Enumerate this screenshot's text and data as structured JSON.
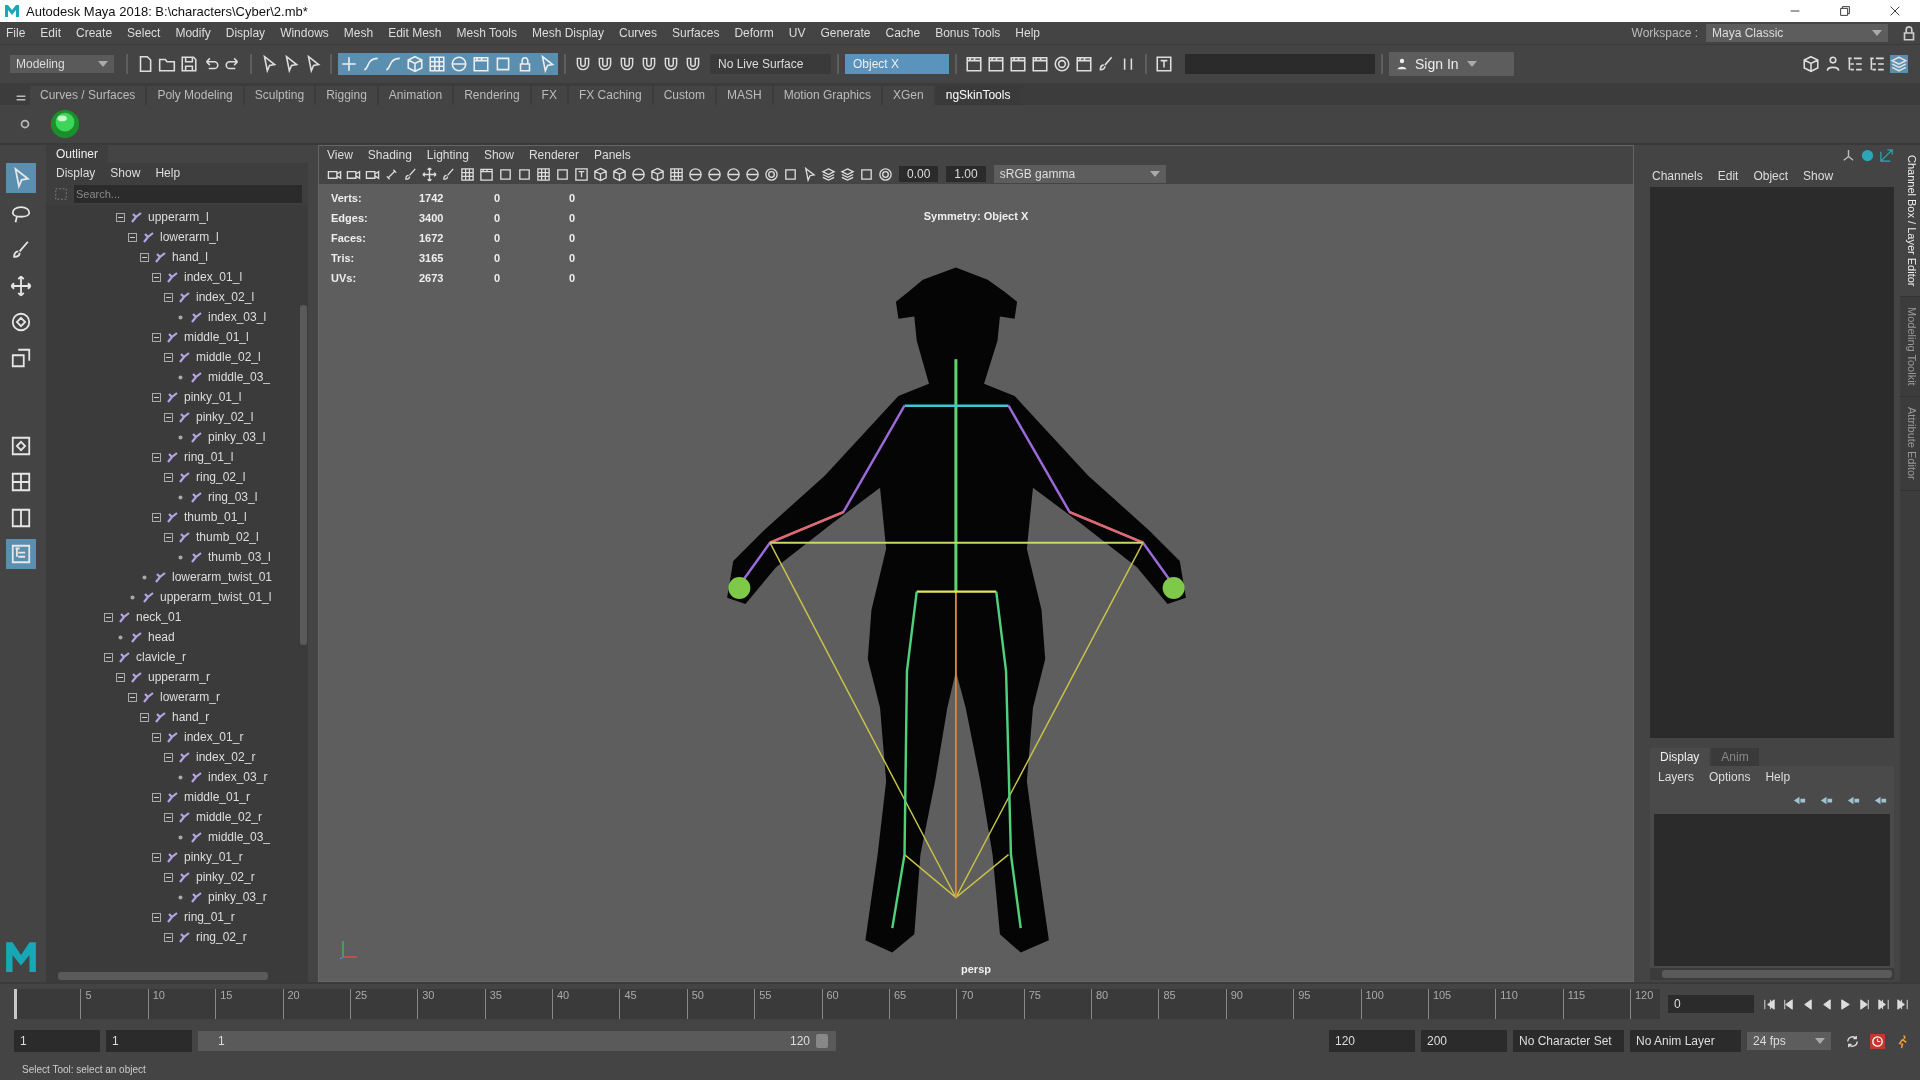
{
  "window": {
    "title": "Autodesk Maya 2018: B:\\characters\\Cyber\\2.mb*"
  },
  "menu_bar": [
    "File",
    "Edit",
    "Create",
    "Select",
    "Modify",
    "Display",
    "Windows",
    "Mesh",
    "Edit Mesh",
    "Mesh Tools",
    "Mesh Display",
    "Curves",
    "Surfaces",
    "Deform",
    "UV",
    "Generate",
    "Cache",
    "Bonus Tools",
    "Help"
  ],
  "workspace": {
    "label": "Workspace :",
    "value": "Maya Classic"
  },
  "status_line": {
    "menu_set": "Modeling",
    "live_surface": "No Live Surface",
    "symmetry": "Object X",
    "sign_in": "Sign In"
  },
  "shelf_tabs": [
    {
      "label": "Curves / Surfaces",
      "selected": false
    },
    {
      "label": "Poly Modeling",
      "selected": false
    },
    {
      "label": "Sculpting",
      "selected": false
    },
    {
      "label": "Rigging",
      "selected": false
    },
    {
      "label": "Animation",
      "selected": false
    },
    {
      "label": "Rendering",
      "selected": false
    },
    {
      "label": "FX",
      "selected": false
    },
    {
      "label": "FX Caching",
      "selected": false
    },
    {
      "label": "Custom",
      "selected": false
    },
    {
      "label": "MASH",
      "selected": false
    },
    {
      "label": "Motion Graphics",
      "selected": false
    },
    {
      "label": "XGen",
      "selected": false
    },
    {
      "label": "ngSkinTools",
      "selected": true
    }
  ],
  "toolbox": [
    {
      "kind": "select",
      "selected": true
    },
    {
      "kind": "lasso",
      "selected": false
    },
    {
      "kind": "paint",
      "selected": false
    },
    {
      "kind": "move",
      "selected": false
    },
    {
      "kind": "rotate",
      "selected": false
    },
    {
      "kind": "scale",
      "selected": false
    },
    {
      "kind": "single",
      "selected": false
    },
    {
      "kind": "four",
      "selected": false
    },
    {
      "kind": "two",
      "selected": false
    },
    {
      "kind": "outliner",
      "selected": true
    }
  ],
  "outliner": {
    "title": "Outliner",
    "menu": [
      "Display",
      "Show",
      "Help"
    ],
    "search": {
      "placeholder": "Search..."
    },
    "tree": [
      {
        "children": [
          {
            "label": "upperarm_l",
            "expanded": true,
            "children": [
              {
                "label": "lowerarm_l",
                "expanded": true,
                "children": [
                  {
                    "label": "hand_l",
                    "expanded": true,
                    "children": [
                      {
                        "label": "index_01_l",
                        "expanded": true,
                        "children": [
                          {
                            "label": "index_02_l",
                            "expanded": true,
                            "children": [
                              {
                                "label": "index_03_l"
                              }
                            ]
                          }
                        ]
                      },
                      {
                        "label": "middle_01_l",
                        "expanded": true,
                        "children": [
                          {
                            "label": "middle_02_l",
                            "expanded": true,
                            "children": [
                              {
                                "label": "middle_03_"
                              }
                            ]
                          }
                        ]
                      },
                      {
                        "label": "pinky_01_l",
                        "expanded": true,
                        "children": [
                          {
                            "label": "pinky_02_l",
                            "expanded": true,
                            "children": [
                              {
                                "label": "pinky_03_l"
                              }
                            ]
                          }
                        ]
                      },
                      {
                        "label": "ring_01_l",
                        "expanded": true,
                        "children": [
                          {
                            "label": "ring_02_l",
                            "expanded": true,
                            "children": [
                              {
                                "label": "ring_03_l"
                              }
                            ]
                          }
                        ]
                      },
                      {
                        "label": "thumb_01_l",
                        "expanded": true,
                        "children": [
                          {
                            "label": "thumb_02_l",
                            "expanded": true,
                            "children": [
                              {
                                "label": "thumb_03_l"
                              }
                            ]
                          }
                        ]
                      }
                    ]
                  },
                  {
                    "label": "lowerarm_twist_01"
                  }
                ]
              },
              {
                "label": "upperarm_twist_01_l"
              }
            ]
          }
        ]
      },
      {
        "label": "neck_01",
        "expanded": true,
        "children": [
          {
            "label": "head"
          }
        ]
      },
      {
        "label": "clavicle_r",
        "expanded": true,
        "children": [
          {
            "label": "upperarm_r",
            "expanded": true,
            "children": [
              {
                "label": "lowerarm_r",
                "expanded": true,
                "children": [
                  {
                    "label": "hand_r",
                    "expanded": true,
                    "children": [
                      {
                        "label": "index_01_r",
                        "expanded": true,
                        "children": [
                          {
                            "label": "index_02_r",
                            "expanded": true,
                            "children": [
                              {
                                "label": "index_03_r"
                              }
                            ]
                          }
                        ]
                      },
                      {
                        "label": "middle_01_r",
                        "expanded": true,
                        "children": [
                          {
                            "label": "middle_02_r",
                            "expanded": true,
                            "children": [
                              {
                                "label": "middle_03_"
                              }
                            ]
                          }
                        ]
                      },
                      {
                        "label": "pinky_01_r",
                        "expanded": true,
                        "children": [
                          {
                            "label": "pinky_02_r",
                            "expanded": true,
                            "children": [
                              {
                                "label": "pinky_03_r"
                              }
                            ]
                          }
                        ]
                      },
                      {
                        "label": "ring_01_r",
                        "expanded": true,
                        "children": [
                          {
                            "label": "ring_02_r",
                            "expanded": true
                          }
                        ]
                      }
                    ]
                  }
                ]
              }
            ]
          }
        ]
      }
    ]
  },
  "viewport": {
    "menu": [
      "View",
      "Shading",
      "Lighting",
      "Show",
      "Renderer",
      "Panels"
    ],
    "exposure": "0.00",
    "gamma": "1.00",
    "color_space": "sRGB gamma",
    "hud": {
      "rows": [
        {
          "label": "Verts:",
          "values": [
            "1742",
            "0",
            "0"
          ]
        },
        {
          "label": "Edges:",
          "values": [
            "3400",
            "0",
            "0"
          ]
        },
        {
          "label": "Faces:",
          "values": [
            "1672",
            "0",
            "0"
          ]
        },
        {
          "label": "Tris:",
          "values": [
            "3165",
            "0",
            "0"
          ]
        },
        {
          "label": "UVs:",
          "values": [
            "2673",
            "0",
            "0"
          ]
        }
      ],
      "symmetry": "Symmetry: Object X",
      "camera": "persp"
    }
  },
  "channel_box": {
    "menu": [
      "Channels",
      "Edit",
      "Object",
      "Show"
    ]
  },
  "layer_editor": {
    "tabs": [
      {
        "label": "Display",
        "selected": true
      },
      {
        "label": "Anim",
        "selected": false
      }
    ],
    "menu": [
      "Layers",
      "Options",
      "Help"
    ]
  },
  "side_tabs": [
    {
      "label": "Channel Box / Layer Editor",
      "selected": true
    },
    {
      "label": "Modeling Toolkit",
      "selected": false
    },
    {
      "label": "Attribute Editor",
      "selected": false
    }
  ],
  "time_slider": {
    "level": 0,
    "ticks": [
      "5",
      "10",
      "15",
      "20",
      "25",
      "30",
      "35",
      "40",
      "45",
      "50",
      "55",
      "60",
      "65",
      "70",
      "75",
      "80",
      "85",
      "90",
      "95",
      "100",
      "105",
      "110",
      "115",
      "120"
    ],
    "current_frame": "0"
  },
  "range_slider": {
    "start": "1",
    "playback_start": "1",
    "range_start": "1",
    "range_end": "120",
    "playback_end": "120",
    "end": "200",
    "character_set": "No Character Set",
    "anim_layer": "No Anim Layer",
    "fps": "24 fps"
  },
  "help_line": "Select Tool: select an object"
}
